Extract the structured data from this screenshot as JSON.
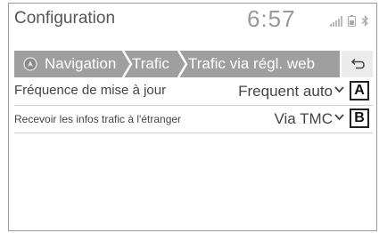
{
  "header": {
    "title": "Configuration",
    "clock": "6:57"
  },
  "breadcrumb": {
    "items": [
      "Navigation",
      "Trafic",
      "Trafic via régl. web"
    ]
  },
  "settings": [
    {
      "label": "Fréquence de mise à jour",
      "value": "Frequent auto",
      "marker": "A"
    },
    {
      "label": "Recevoir les infos trafic à l'étranger",
      "value": "Via TMC",
      "marker": "B"
    }
  ],
  "colors": {
    "breadcrumb_bg": "#9f9f9f",
    "back_bg": "#ececec",
    "text": "#444444"
  }
}
